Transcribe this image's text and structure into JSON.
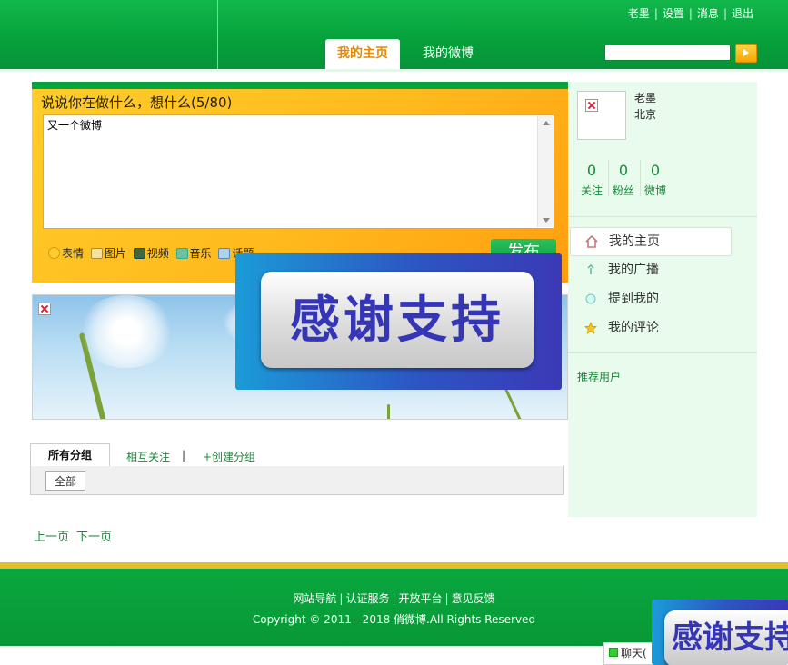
{
  "header": {
    "top_links": [
      "老墨",
      "设置",
      "消息",
      "退出"
    ],
    "tabs": [
      "我的主页",
      "我的微博"
    ],
    "search_value": ""
  },
  "publish": {
    "title": "说说你在做什么，想什么(5/80)",
    "text": "又一个微博",
    "tools": [
      "表情",
      "图片",
      "视频",
      "音乐",
      "话题"
    ],
    "send_label": "发布"
  },
  "groups": {
    "tabs": [
      "所有分组",
      "相互关注",
      "+创建分组"
    ],
    "separator": "|",
    "all_button": "全部"
  },
  "pager": {
    "prev": "上一页",
    "next": "下一页"
  },
  "profile": {
    "name": "老墨",
    "location": "北京",
    "stats": [
      {
        "count": "0",
        "label": "关注"
      },
      {
        "count": "0",
        "label": "粉丝"
      },
      {
        "count": "0",
        "label": "微博"
      }
    ]
  },
  "menu": [
    "我的主页",
    "我的广播",
    "提到我的",
    "我的评论"
  ],
  "menu_icons": [
    "home-icon",
    "broadcast-icon",
    "mention-icon",
    "star-icon"
  ],
  "recommend_label": "推荐用户",
  "footer": {
    "links": [
      "网站导航",
      "认证服务",
      "开放平台",
      "意见反馈"
    ],
    "copyright": "Copyright © 2011 - 2018 俏微博.All Rights Reserved"
  },
  "ads": {
    "thanks_text": "感谢支持"
  },
  "chat": {
    "label": "聊天("
  },
  "colors": {
    "brand_green": "#07a13c",
    "accent_orange": "#e68a00",
    "publish_yellow": "#ffc21f"
  }
}
